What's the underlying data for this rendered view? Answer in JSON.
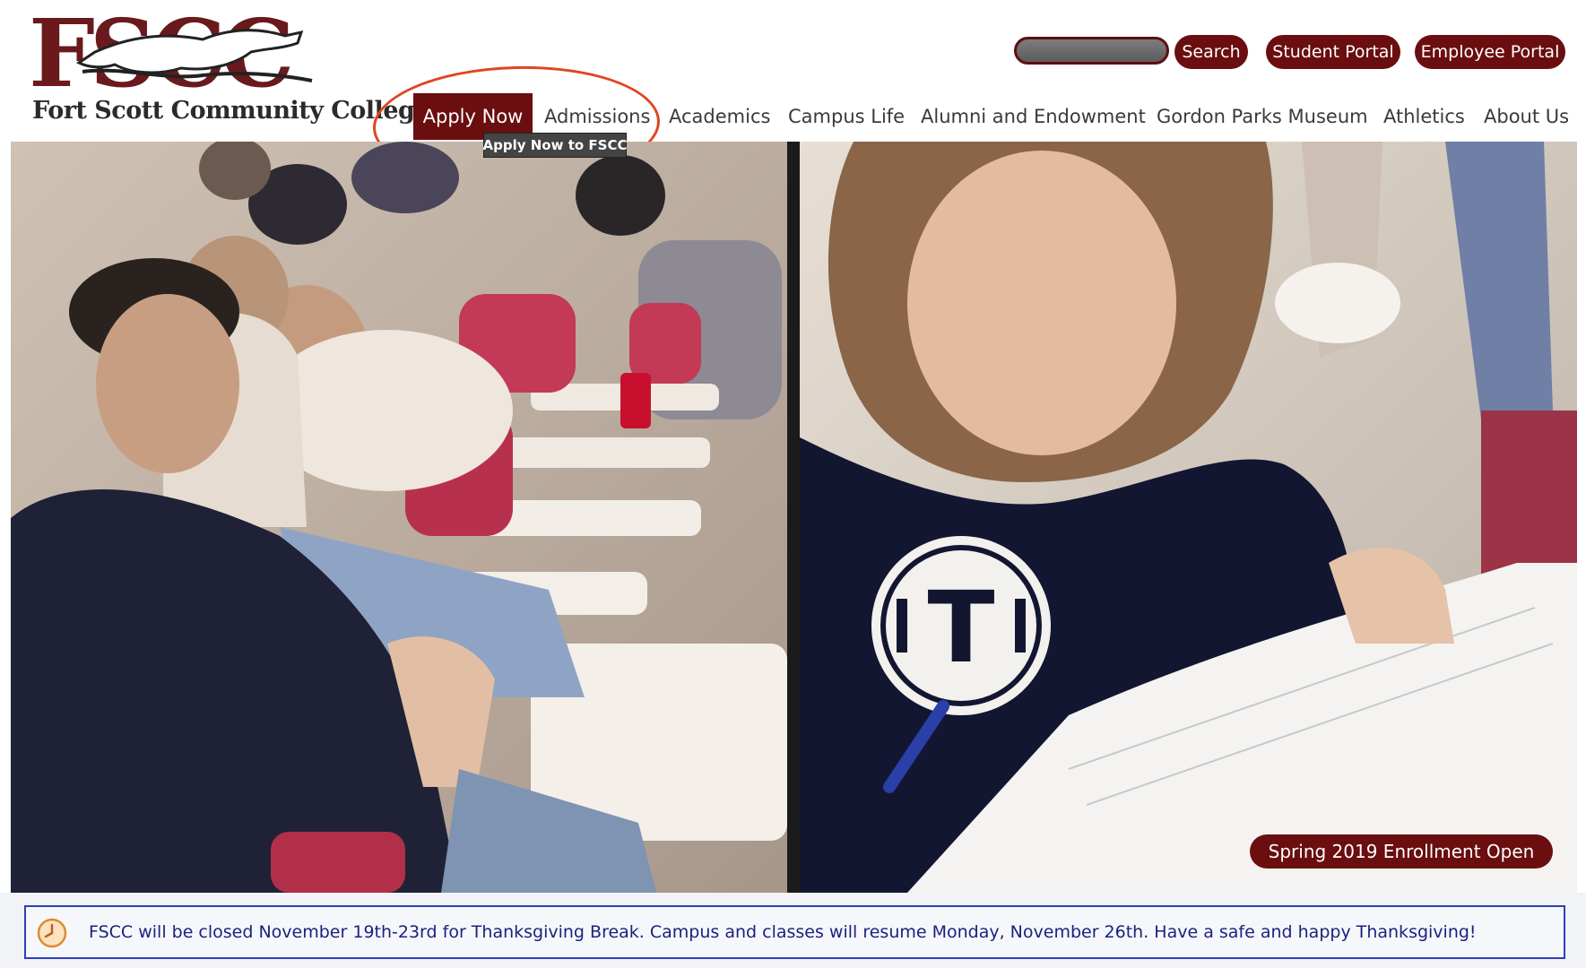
{
  "logo": {
    "mark": "FSCC",
    "college_name": "Fort Scott Community College"
  },
  "search": {
    "button_label": "Search"
  },
  "portals": {
    "student_label": "Student Portal",
    "employee_label": "Employee Portal"
  },
  "nav": {
    "items": [
      {
        "label": "Apply Now"
      },
      {
        "label": "Admissions"
      },
      {
        "label": "Academics"
      },
      {
        "label": "Campus Life"
      },
      {
        "label": "Alumni and Endowment"
      },
      {
        "label": "Gordon Parks Museum"
      },
      {
        "label": "Athletics"
      },
      {
        "label": "About Us"
      }
    ],
    "active_index": 0,
    "tooltip": "Apply Now to FSCC"
  },
  "hero": {
    "enroll_label": "Spring 2019 Enrollment Open",
    "shirt_letter": "T"
  },
  "alert": {
    "icon": "clock-icon",
    "message": "FSCC will be closed November 19th-23rd for Thanksgiving Break. Campus and classes will resume Monday, November 26th. Have a safe and happy Thanksgiving!"
  },
  "colors": {
    "brand": "#6a0e10",
    "nav_text": "#3a3a3a",
    "alert_border": "#2f3fb8",
    "alert_text": "#1a237e",
    "highlight": "#e0451f"
  }
}
